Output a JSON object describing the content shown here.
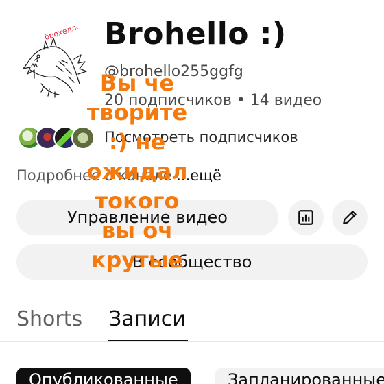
{
  "channel": {
    "avatar_caption": "брохелло",
    "title": "Brohello :)",
    "handle": "@brohello255ggfg",
    "stats": "20 подписчиков • 14 видео",
    "see_subscribers": "Посмотреть подписчиков",
    "about": "Подробнее о канале",
    "about_more": "...ещё"
  },
  "actions": {
    "manage_videos": "Управление видео",
    "stats_icon": "bar-chart-icon",
    "edit_icon": "pencil-icon",
    "community": "В сообщество"
  },
  "tabs": [
    {
      "label": "Shorts",
      "selected": false
    },
    {
      "label": "Записи",
      "selected": true
    }
  ],
  "filters": {
    "published": "Опубликованные",
    "scheduled": "Запланированные"
  },
  "overlay": {
    "color": "#f47a0e",
    "lines": [
      "Вы че",
      "творите",
      ":) не",
      "ожидал",
      "токого",
      "вы оч",
      "крутые"
    ]
  }
}
